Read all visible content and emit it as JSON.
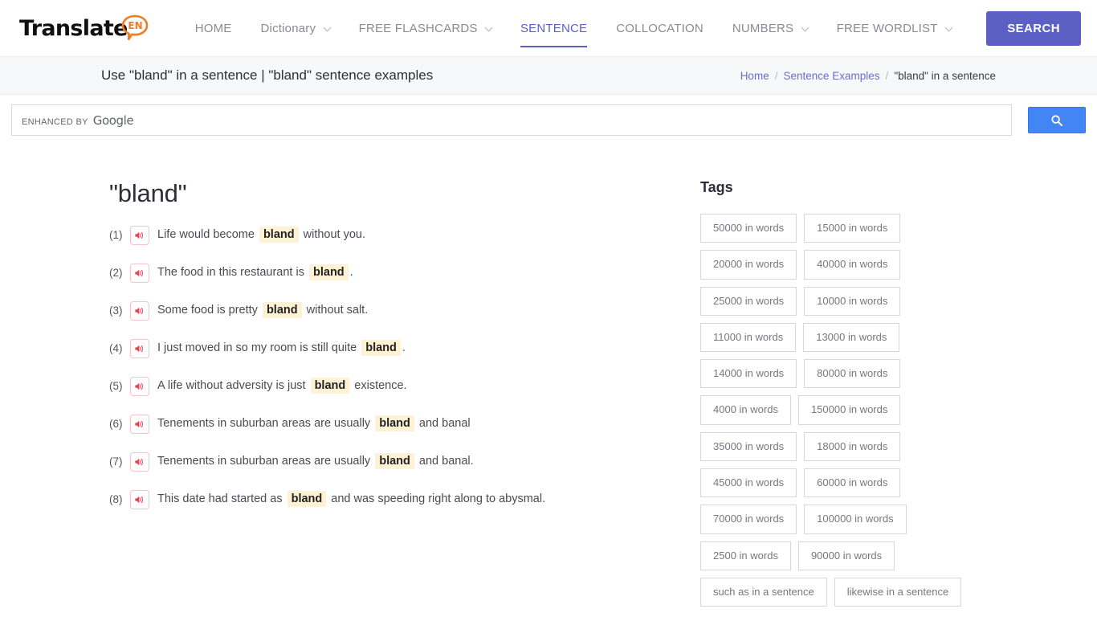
{
  "header": {
    "logo": {
      "text": "Translate",
      "badge": "EN",
      "name": "translate-en-logo"
    },
    "nav": [
      {
        "label": "HOME",
        "has_caret": false,
        "active": false
      },
      {
        "label": "Dictionary",
        "has_caret": true,
        "active": false
      },
      {
        "label": "FREE FLASHCARDS",
        "has_caret": true,
        "active": false
      },
      {
        "label": "SENTENCE",
        "has_caret": false,
        "active": true
      },
      {
        "label": "COLLOCATION",
        "has_caret": false,
        "active": false
      },
      {
        "label": "NUMBERS",
        "has_caret": true,
        "active": false
      },
      {
        "label": "FREE WORDLIST",
        "has_caret": true,
        "active": false
      }
    ],
    "search_button": "SEARCH",
    "accent_color": "#5c5fc4"
  },
  "subbar": {
    "title": "Use \"bland\" in a sentence | \"bland\" sentence examples",
    "breadcrumb": {
      "home": "Home",
      "sep1": "/",
      "section": "Sentence Examples",
      "sep2": "/",
      "current": "\"bland\" in a sentence"
    }
  },
  "google_search": {
    "enhanced_label": "ENHANCED BY",
    "brand": "Google",
    "value": "",
    "button_icon": "search-icon",
    "button_color": "#4285f4"
  },
  "main": {
    "word_title": "\"bland\"",
    "keyword": "bland",
    "highlight_color": "#fdf2d4",
    "sentences": [
      {
        "num": "(1)",
        "before": "Life would become ",
        "word": "bland",
        "after": " without you."
      },
      {
        "num": "(2)",
        "before": "The food in this restaurant is ",
        "word": "bland",
        "after": "."
      },
      {
        "num": "(3)",
        "before": "Some food is pretty ",
        "word": "bland",
        "after": " without salt."
      },
      {
        "num": "(4)",
        "before": "I just moved in so my room is still quite ",
        "word": "bland",
        "after": "."
      },
      {
        "num": "(5)",
        "before": "A life without adversity is just ",
        "word": "bland",
        "after": " existence."
      },
      {
        "num": "(6)",
        "before": "Tenements in suburban areas are usually ",
        "word": "bland",
        "after": " and banal"
      },
      {
        "num": "(7)",
        "before": "Tenements in suburban areas are usually ",
        "word": "bland",
        "after": " and banal."
      },
      {
        "num": "(8)",
        "before": "This date had started as ",
        "word": "bland",
        "after": " and was speeding right along to abysmal."
      }
    ]
  },
  "sidebar": {
    "tags_title": "Tags",
    "tags": [
      "50000 in words",
      "15000 in words",
      "20000 in words",
      "40000 in words",
      "25000 in words",
      "10000 in words",
      "11000 in words",
      "13000 in words",
      "14000 in words",
      "80000 in words",
      "4000 in words",
      "150000 in words",
      "35000 in words",
      "18000 in words",
      "45000 in words",
      "60000 in words",
      "70000 in words",
      "100000 in words",
      "2500 in words",
      "90000 in words",
      "such as in a sentence",
      "likewise in a sentence"
    ]
  }
}
